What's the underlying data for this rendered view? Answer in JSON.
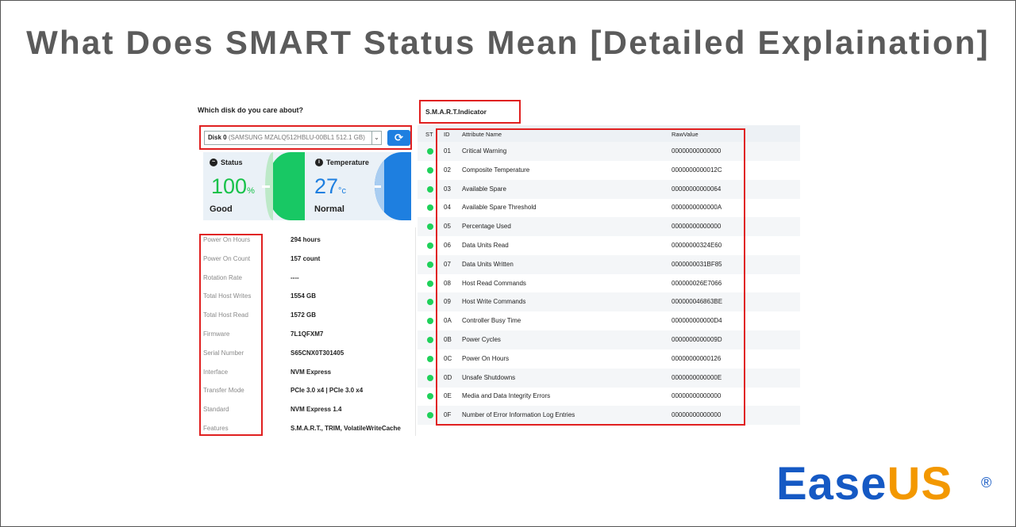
{
  "page": {
    "title": "What Does SMART Status Mean [Detailed Explaination]"
  },
  "left_panel": {
    "question": "Which disk do you care about?",
    "disk_name": "Disk 0",
    "disk_model": "(SAMSUNG MZALQ512HBLU-00BL1 512.1 GB)",
    "status": {
      "label": "Status",
      "value": "100",
      "unit": "%",
      "state": "Good",
      "color": "#18c24a",
      "icon": "pulse-icon"
    },
    "temperature": {
      "label": "Temperature",
      "value": "27",
      "unit": "°c",
      "state": "Normal",
      "color": "#1e7fe0",
      "icon": "thermometer-icon"
    },
    "info": [
      {
        "label": "Power On Hours",
        "value": "294 hours"
      },
      {
        "label": "Power On Count",
        "value": "157 count"
      },
      {
        "label": "Rotation Rate",
        "value": "----"
      },
      {
        "label": "Total Host Writes",
        "value": "1554 GB"
      },
      {
        "label": "Total Host Read",
        "value": "1572 GB"
      },
      {
        "label": "Firmware",
        "value": "7L1QFXM7"
      },
      {
        "label": "Serial Number",
        "value": "S65CNX0T301405"
      },
      {
        "label": "Interface",
        "value": "NVM Express"
      },
      {
        "label": "Transfer Mode",
        "value": "PCIe 3.0 x4 | PCIe 3.0 x4"
      },
      {
        "label": "Standard",
        "value": "NVM Express 1.4"
      },
      {
        "label": "Features",
        "value": "S.M.A.R.T., TRIM, VolatileWriteCache"
      }
    ]
  },
  "right_panel": {
    "title": "S.M.A.R.T.Indicator",
    "headers": {
      "st": "ST",
      "id": "ID",
      "name": "Attribute Name",
      "raw": "RawValue"
    },
    "rows": [
      {
        "id": "01",
        "name": "Critical Warning",
        "raw": "00000000000000"
      },
      {
        "id": "02",
        "name": "Composite Temperature",
        "raw": "0000000000012C"
      },
      {
        "id": "03",
        "name": "Available Spare",
        "raw": "00000000000064"
      },
      {
        "id": "04",
        "name": "Available Spare Threshold",
        "raw": "0000000000000A"
      },
      {
        "id": "05",
        "name": "Percentage Used",
        "raw": "00000000000000"
      },
      {
        "id": "06",
        "name": "Data Units Read",
        "raw": "00000000324E60"
      },
      {
        "id": "07",
        "name": "Data Units Written",
        "raw": "0000000031BF85"
      },
      {
        "id": "08",
        "name": "Host Read Commands",
        "raw": "000000026E7066"
      },
      {
        "id": "09",
        "name": "Host Write Commands",
        "raw": "000000046863BE"
      },
      {
        "id": "0A",
        "name": "Controller Busy Time",
        "raw": "000000000000D4"
      },
      {
        "id": "0B",
        "name": "Power Cycles",
        "raw": "0000000000009D"
      },
      {
        "id": "0C",
        "name": "Power On Hours",
        "raw": "00000000000126"
      },
      {
        "id": "0D",
        "name": "Unsafe Shutdowns",
        "raw": "0000000000000E"
      },
      {
        "id": "0E",
        "name": "Media and Data Integrity Errors",
        "raw": "00000000000000"
      },
      {
        "id": "0F",
        "name": "Number of Error Information Log Entries",
        "raw": "00000000000000"
      }
    ],
    "status_color": "#1fd15a"
  },
  "logo": {
    "ease": "Ease",
    "us": "US",
    "reg": "®"
  }
}
